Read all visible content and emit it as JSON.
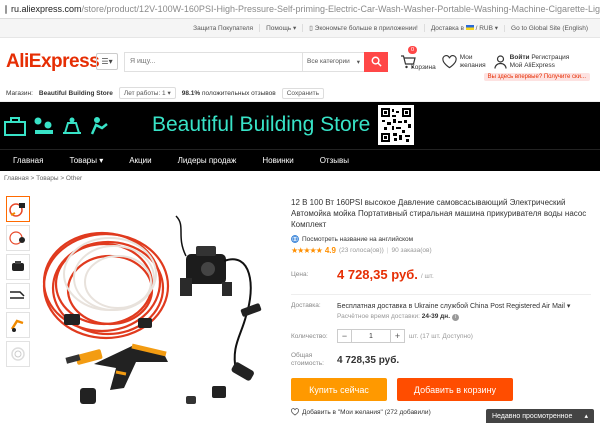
{
  "url": {
    "domain": "ru.aliexpress.com",
    "path": "/store/product/12V-100W-160PSI-High-Pressure-Self-priming-Electric-Car-Wash-Washer-Portable-Washing-Machine-Cigarette-Lighter/3085068_32"
  },
  "topstrip": {
    "protection": "Защита Покупателя",
    "help": "Помощь",
    "app": "Экономьте больше в приложении!",
    "delivery": "Доставка в",
    "currency": "/ RUB",
    "global": "Go to Global Site (English)"
  },
  "header": {
    "logo": "AliExpress",
    "search_placeholder": "Я ищу...",
    "search_category": "Все категории",
    "cart_label": "Корзина",
    "cart_count": "0",
    "wish_label_1": "Мои",
    "wish_label_2": "желания",
    "login": "Войти",
    "register": "Регистрация",
    "my_ali": "Мой AliExpress",
    "promo": "Вы здесь впервые? Получите ски..."
  },
  "store": {
    "label": "Магазин:",
    "name": "Beautiful Building Store",
    "years": "Лет работы: 1",
    "percent": "98.1%",
    "feedback": "положительных отзывов",
    "save": "Сохранить"
  },
  "banner": {
    "title": "Beautiful Building Store",
    "accent": "#38e3c7"
  },
  "nav": {
    "items": [
      "Главная",
      "Товары ▾",
      "Акции",
      "Лидеры продаж",
      "Новинки",
      "Отзывы"
    ]
  },
  "breadcrumb": "Главная > Товары > Other",
  "product": {
    "title": "12 В 100 Вт 160PSI высокое Давление самовсасывающий Электрический Автомойка мойка Портативный стиральная машина прикуривателя воды насос Комплект",
    "translate": "Посмотреть название на английском",
    "stars": "★★★★★",
    "rating": "4.9",
    "reviews": "(23 голоса(ов))",
    "orders": "90 заказа(ов)",
    "price_label": "Цена:",
    "price": "4 728,35 руб.",
    "price_unit": "/ шт.",
    "delivery_label": "Доставка:",
    "delivery_text": "Бесплатная доставка в Ukraine службой China Post Registered Air Mail",
    "delivery_time_label": "Расчётное время доставки:",
    "delivery_time": "24-39 дн.",
    "qty_label": "Количество:",
    "qty": "1",
    "qty_avail": "шт. (17 шт. Доступно)",
    "total_label_1": "Общая",
    "total_label_2": "стоимость:",
    "total": "4 728,35 руб.",
    "buy_now": "Купить сейчас",
    "add_cart": "Добавить в корзину",
    "wishlist": "Добавить в \"Мои желания\" (272 добавили)"
  },
  "recent": "Недавно просмотренное"
}
